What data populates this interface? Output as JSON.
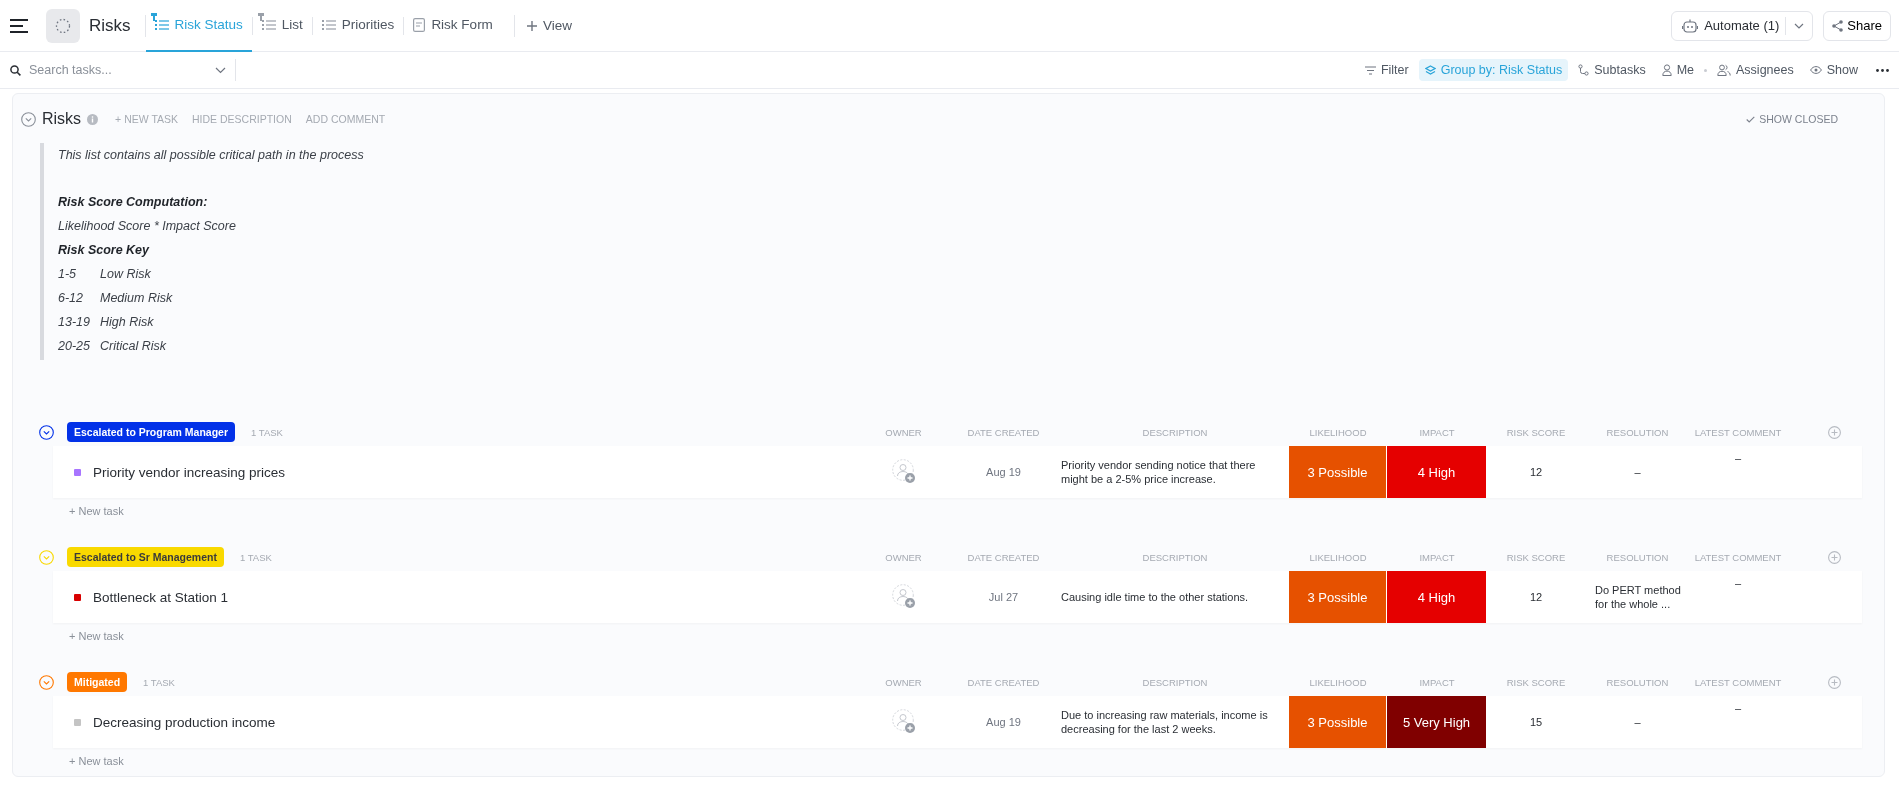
{
  "header": {
    "title": "Risks",
    "views": [
      {
        "label": "Risk Status",
        "kind": "list",
        "pinned": true,
        "selected": true
      },
      {
        "label": "List",
        "kind": "list",
        "pinned": true,
        "selected": false
      },
      {
        "label": "Priorities",
        "kind": "list",
        "pinned": false,
        "selected": false
      },
      {
        "label": "Risk Form",
        "kind": "form",
        "pinned": false,
        "selected": false
      }
    ],
    "add_view": "View",
    "automate": "Automate (1)",
    "share": "Share"
  },
  "toolbar": {
    "search_placeholder": "Search tasks...",
    "items": [
      {
        "label": "Filter",
        "kind": "filter",
        "selected": false
      },
      {
        "label": "Group by: Risk Status",
        "kind": "group",
        "selected": true
      },
      {
        "label": "Subtasks",
        "kind": "subtasks",
        "selected": false
      },
      {
        "label": "Me",
        "kind": "me",
        "selected": false
      },
      {
        "label": "Assignees",
        "kind": "assignees",
        "selected": false
      },
      {
        "label": "Show",
        "kind": "show",
        "selected": false
      }
    ]
  },
  "list": {
    "title": "Risks",
    "actions": [
      "+ NEW TASK",
      "HIDE DESCRIPTION",
      "ADD COMMENT"
    ],
    "show_closed": "SHOW CLOSED",
    "description": [
      {
        "kind": "intro",
        "text": "This list contains all possible critical path in the process"
      },
      {
        "kind": "heading",
        "text": "Risk Score Computation:"
      },
      {
        "kind": "line",
        "text": "Likelihood Score * Impact Score"
      },
      {
        "kind": "heading",
        "text": "Risk Score Key"
      },
      {
        "kind": "key",
        "range": "1-5",
        "label": "Low Risk"
      },
      {
        "kind": "key",
        "range": "6-12",
        "label": "Medium Risk"
      },
      {
        "kind": "key",
        "range": "13-19",
        "label": "High Risk"
      },
      {
        "kind": "key",
        "range": "20-25",
        "label": "Critical Risk"
      }
    ]
  },
  "groups": [
    {
      "status": "Escalated to Program Manager",
      "color": "#0231e8",
      "count": "1 TASK",
      "columns": [
        "OWNER",
        "DATE CREATED",
        "DESCRIPTION",
        "LIKELIHOOD",
        "IMPACT",
        "RISK SCORE",
        "RESOLUTION",
        "LATEST COMMENT"
      ],
      "new_task": "+ New task",
      "tasks": [
        {
          "name": "Priority vendor increasing prices",
          "color": "#a875ff",
          "date": "Aug 19",
          "description": "Priority vendor sending notice that there might be a 2-5% price increase.",
          "likelihood": {
            "text": "3 Possible",
            "color": "#e65100"
          },
          "impact": {
            "text": "4 High",
            "color": "#e50000"
          },
          "score": "12",
          "resolution": "–",
          "comment": "–"
        }
      ]
    },
    {
      "status": "Escalated to Sr Management",
      "color": "#f9d900",
      "count": "1 TASK",
      "columns": [
        "OWNER",
        "DATE CREATED",
        "DESCRIPTION",
        "LIKELIHOOD",
        "IMPACT",
        "RISK SCORE",
        "RESOLUTION",
        "LATEST COMMENT"
      ],
      "new_task": "+ New task",
      "tasks": [
        {
          "name": "Bottleneck at Station 1",
          "color": "#d80000",
          "date": "Jul 27",
          "description": "Causing idle time to the other stations.",
          "likelihood": {
            "text": "3 Possible",
            "color": "#e65100"
          },
          "impact": {
            "text": "4 High",
            "color": "#e50000"
          },
          "score": "12",
          "resolution": "Do PERT method for the whole ...",
          "comment": "–"
        }
      ]
    },
    {
      "status": "Mitigated",
      "color": "#ff7800",
      "count": "1 TASK",
      "columns": [
        "OWNER",
        "DATE CREATED",
        "DESCRIPTION",
        "LIKELIHOOD",
        "IMPACT",
        "RISK SCORE",
        "RESOLUTION",
        "LATEST COMMENT"
      ],
      "new_task": "+ New task",
      "tasks": [
        {
          "name": "Decreasing production income",
          "color": "#c4c4c4",
          "date": "Aug 19",
          "description": "Due to increasing raw materials, income is decreasing for the last 2 weeks.",
          "likelihood": {
            "text": "3 Possible",
            "color": "#e65100"
          },
          "impact": {
            "text": "5 Very High",
            "color": "#800000"
          },
          "score": "15",
          "resolution": "–",
          "comment": "–"
        }
      ]
    }
  ]
}
